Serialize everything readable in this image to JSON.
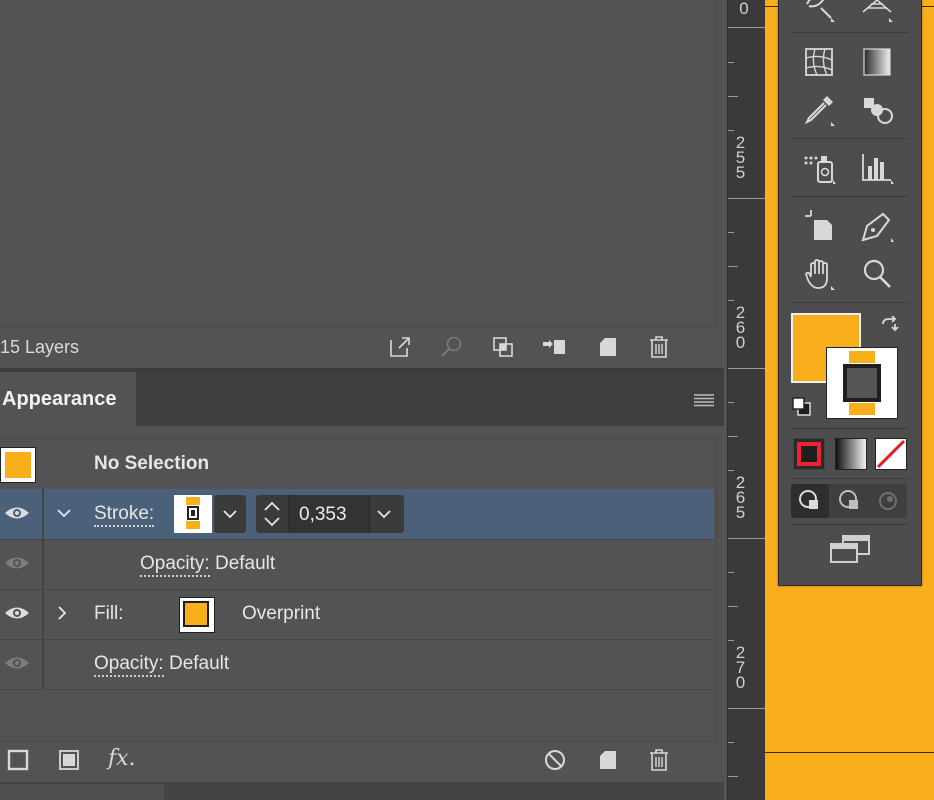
{
  "layers": {
    "count_label": "15 Layers"
  },
  "appearance": {
    "tab_label": "Appearance",
    "header_label": "No Selection",
    "rows": [
      {
        "label": "Stroke:",
        "value": "0,353"
      },
      {
        "label": "Opacity:",
        "value": "Default"
      },
      {
        "label": "Fill:",
        "value": "Overprint"
      },
      {
        "label": "Opacity:",
        "value": "Default"
      }
    ],
    "fx_label": "fx."
  },
  "ruler": {
    "labels": [
      "0",
      "255",
      "260",
      "265",
      "270"
    ]
  },
  "colors": {
    "fill": "#f9ae1b",
    "selection": "#4b6079",
    "panel": "#535353"
  }
}
